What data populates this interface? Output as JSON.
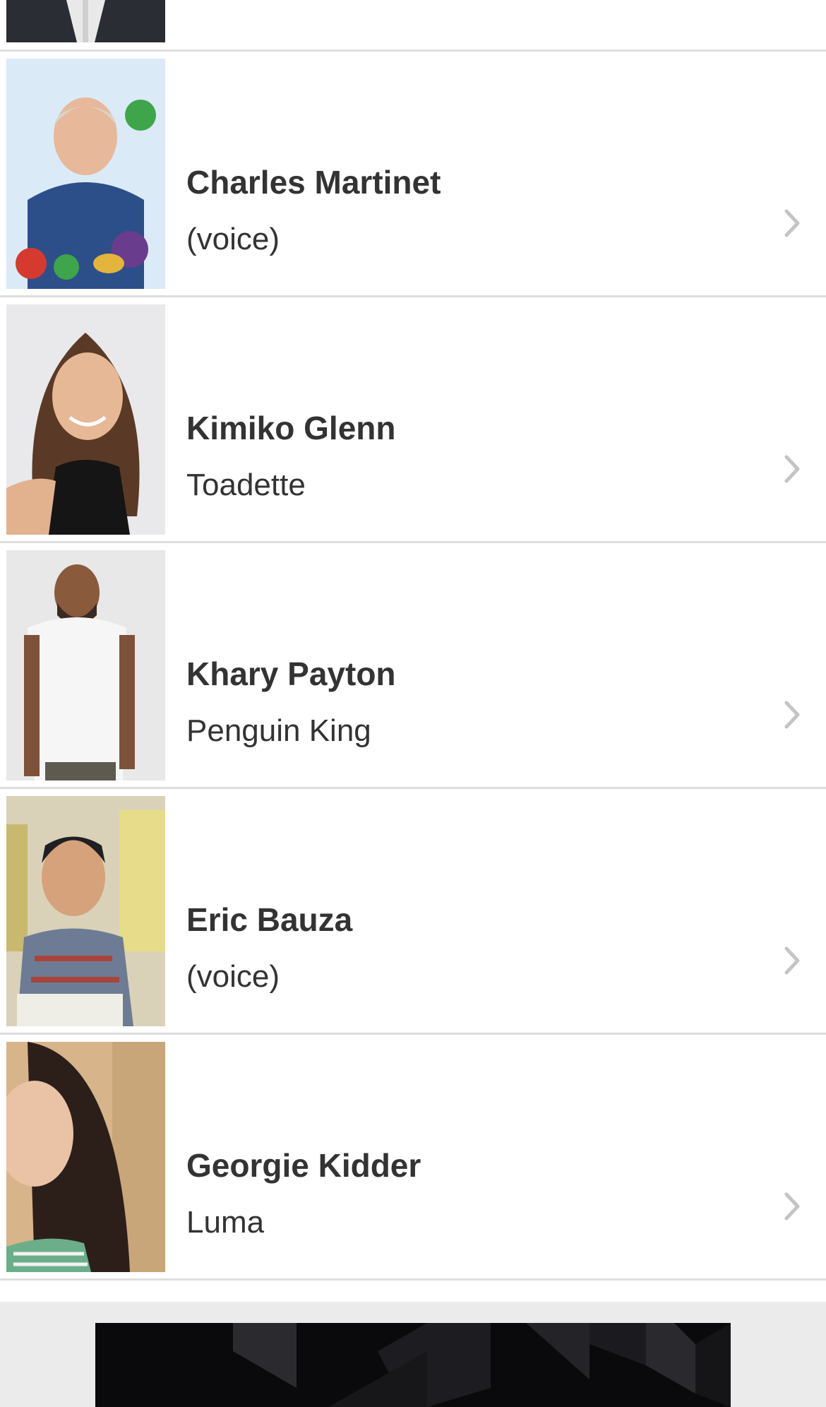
{
  "cast_list": {
    "items": [
      {
        "name": "Charles Martinet",
        "role": "(voice)"
      },
      {
        "name": "Kimiko Glenn",
        "role": "Toadette"
      },
      {
        "name": "Khary Payton",
        "role": "Penguin King"
      },
      {
        "name": "Eric Bauza",
        "role": "(voice)"
      },
      {
        "name": "Georgie Kidder",
        "role": "Luma"
      }
    ]
  },
  "colors": {
    "divider": "#dedede",
    "text": "#333333",
    "chevron": "#c4c4c4",
    "ad_background": "#ebebeb",
    "ad_banner": "#0a0a0c"
  },
  "icons": {
    "row_arrow": "chevron-right-icon"
  }
}
